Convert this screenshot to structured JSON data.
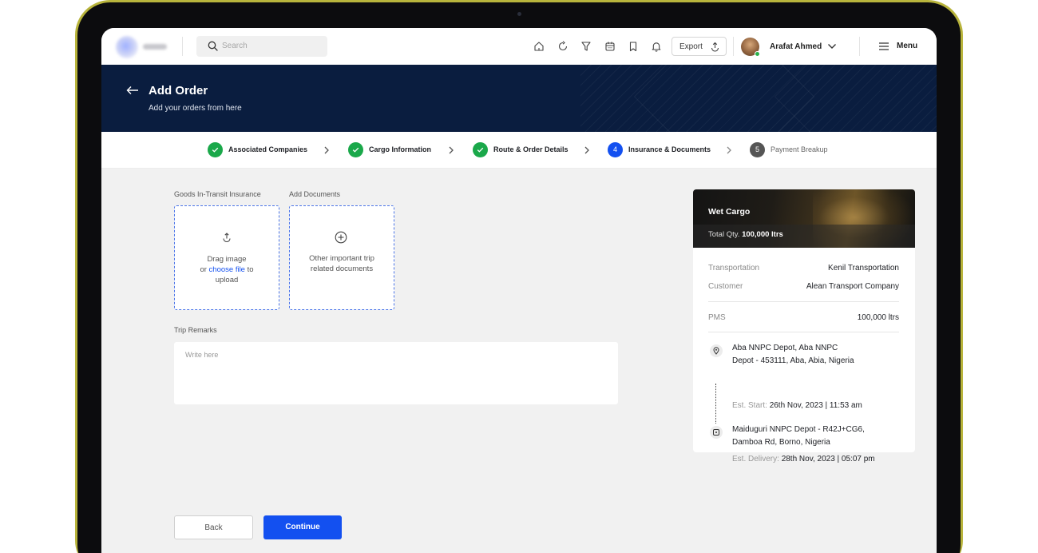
{
  "topbar": {
    "search_placeholder": "Search",
    "nav_icons": [
      "home-icon",
      "refresh-icon",
      "filter-icon",
      "calendar-icon",
      "bookmark-icon",
      "bell-icon"
    ],
    "export_label": "Export",
    "user_name": "Arafat Ahmed",
    "menu_label": "Menu"
  },
  "header": {
    "title": "Add Order",
    "subtitle": "Add your orders from here"
  },
  "stepper": {
    "steps": [
      {
        "label": "Associated Companies",
        "status": "done",
        "marker": ""
      },
      {
        "label": "Cargo Information",
        "status": "done",
        "marker": ""
      },
      {
        "label": "Route & Order Details",
        "status": "done",
        "marker": ""
      },
      {
        "label": "Insurance & Documents",
        "status": "active",
        "marker": "4"
      },
      {
        "label": "Payment Breakup",
        "status": "todo",
        "marker": "5"
      }
    ]
  },
  "form": {
    "insurance_label": "Goods In-Transit Insurance",
    "documents_label": "Add Documents",
    "upload": {
      "line1": "Drag image",
      "line2_prefix": "or ",
      "line2_link": "choose file",
      "line2_suffix": " to",
      "line3": "upload"
    },
    "documents": {
      "line1": "Other important trip",
      "line2": "related documents"
    },
    "remarks_label": "Trip Remarks",
    "remarks_placeholder": "Write here",
    "back_label": "Back",
    "continue_label": "Continue"
  },
  "summary": {
    "cargo_type": "Wet Cargo",
    "total_qty_label": "Total Qty.",
    "total_qty_value": "100,000 ltrs",
    "rows": [
      {
        "key": "Transportation",
        "value": "Kenil Transportation"
      },
      {
        "key": "Customer",
        "value": "Alean Transport Company"
      }
    ],
    "product": {
      "key": "PMS",
      "value": "100,000 ltrs"
    },
    "origin": {
      "line1": "Aba NNPC Depot, Aba NNPC",
      "line2": "Depot - 453111, Aba, Abia, Nigeria",
      "eta_label": "Est. Start:",
      "eta_value": "26th Nov, 2023 | 11:53 am"
    },
    "destination": {
      "line1": "Maiduguri NNPC Depot - R42J+CG6,",
      "line2": "Damboa Rd, Borno, Nigeria",
      "eta_label": "Est. Delivery:",
      "eta_value": "28th Nov, 2023 | 05:07 pm"
    }
  },
  "colors": {
    "primary": "#1350f0",
    "success": "#1aa84a",
    "header_bg": "#0a1d3f",
    "frame": "#b8b43c"
  }
}
